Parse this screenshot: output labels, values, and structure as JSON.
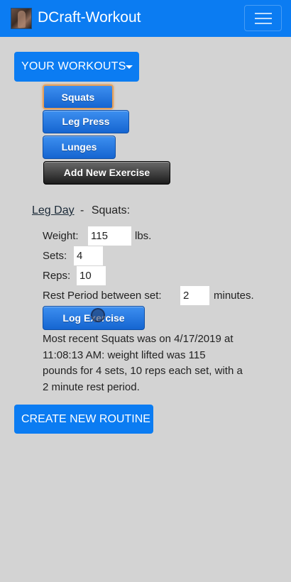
{
  "navbar": {
    "brand_title": "DCraft-Workout",
    "logo_icon": "user-avatar-icon",
    "menu_icon": "hamburger-menu-icon",
    "color": "#0b7cf2"
  },
  "workouts_dropdown": {
    "label": "YOUR WORKOUTS",
    "caret_icon": "caret-down-icon"
  },
  "exercises": [
    {
      "label": "Squats",
      "selected": true
    },
    {
      "label": "Leg Press",
      "selected": false
    },
    {
      "label": "Lunges",
      "selected": false
    }
  ],
  "add_exercise_label": "Add New Exercise",
  "routine": {
    "name": "Leg Day",
    "separator": "-",
    "exercise": "Squats:"
  },
  "form": {
    "weight_label": "Weight:",
    "weight_value": "115",
    "weight_unit": "lbs.",
    "sets_label": "Sets:",
    "sets_value": "4",
    "reps_label": "Reps:",
    "reps_value": "10",
    "rest_label": "Rest Period between set:",
    "rest_value": "2",
    "rest_unit": "minutes."
  },
  "log_button_label": "Log Exercise",
  "recent_lines": [
    "Most recent Squats was on 4/17/2019 at",
    "11:08:13 AM: weight lifted was 115",
    "pounds for 4 sets, 10 reps each set, with a",
    "2 minute rest period."
  ],
  "create_routine_label": "CREATE NEW ROUTINE"
}
